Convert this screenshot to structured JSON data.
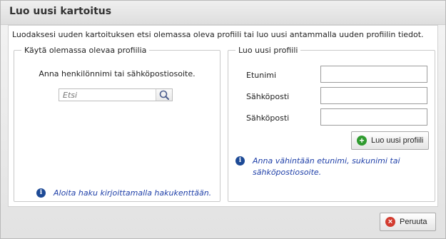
{
  "dialog": {
    "title": "Luo uusi kartoitus"
  },
  "intro": {
    "text": "Luodaksesi uuden kartoituksen etsi olemassa oleva profiili tai luo uusi antammalla uuden profiilin tiedot."
  },
  "existing_profile": {
    "legend": "Käytä olemassa olevaa profiilia",
    "hint": "Anna henkilönnimi tai sähköpostiosoite.",
    "search_placeholder": "Etsi",
    "info": "Aloita haku kirjoittamalla hakukenttään."
  },
  "new_profile": {
    "legend": "Luo uusi profiili",
    "fields": [
      {
        "label": "Etunimi",
        "value": ""
      },
      {
        "label": "Sähköposti",
        "value": ""
      },
      {
        "label": "Sähköposti",
        "value": ""
      }
    ],
    "create_button": "Luo uusi profiili",
    "info": "Anna vähintään etunimi, sukunimi tai sähköpostiosoite."
  },
  "footer": {
    "cancel_button": "Peruuta"
  },
  "colors": {
    "info_text": "#1e3fa8",
    "info_icon": "#1d4a96",
    "add_icon": "#2f9b2f",
    "cancel_icon": "#d23b2f"
  }
}
